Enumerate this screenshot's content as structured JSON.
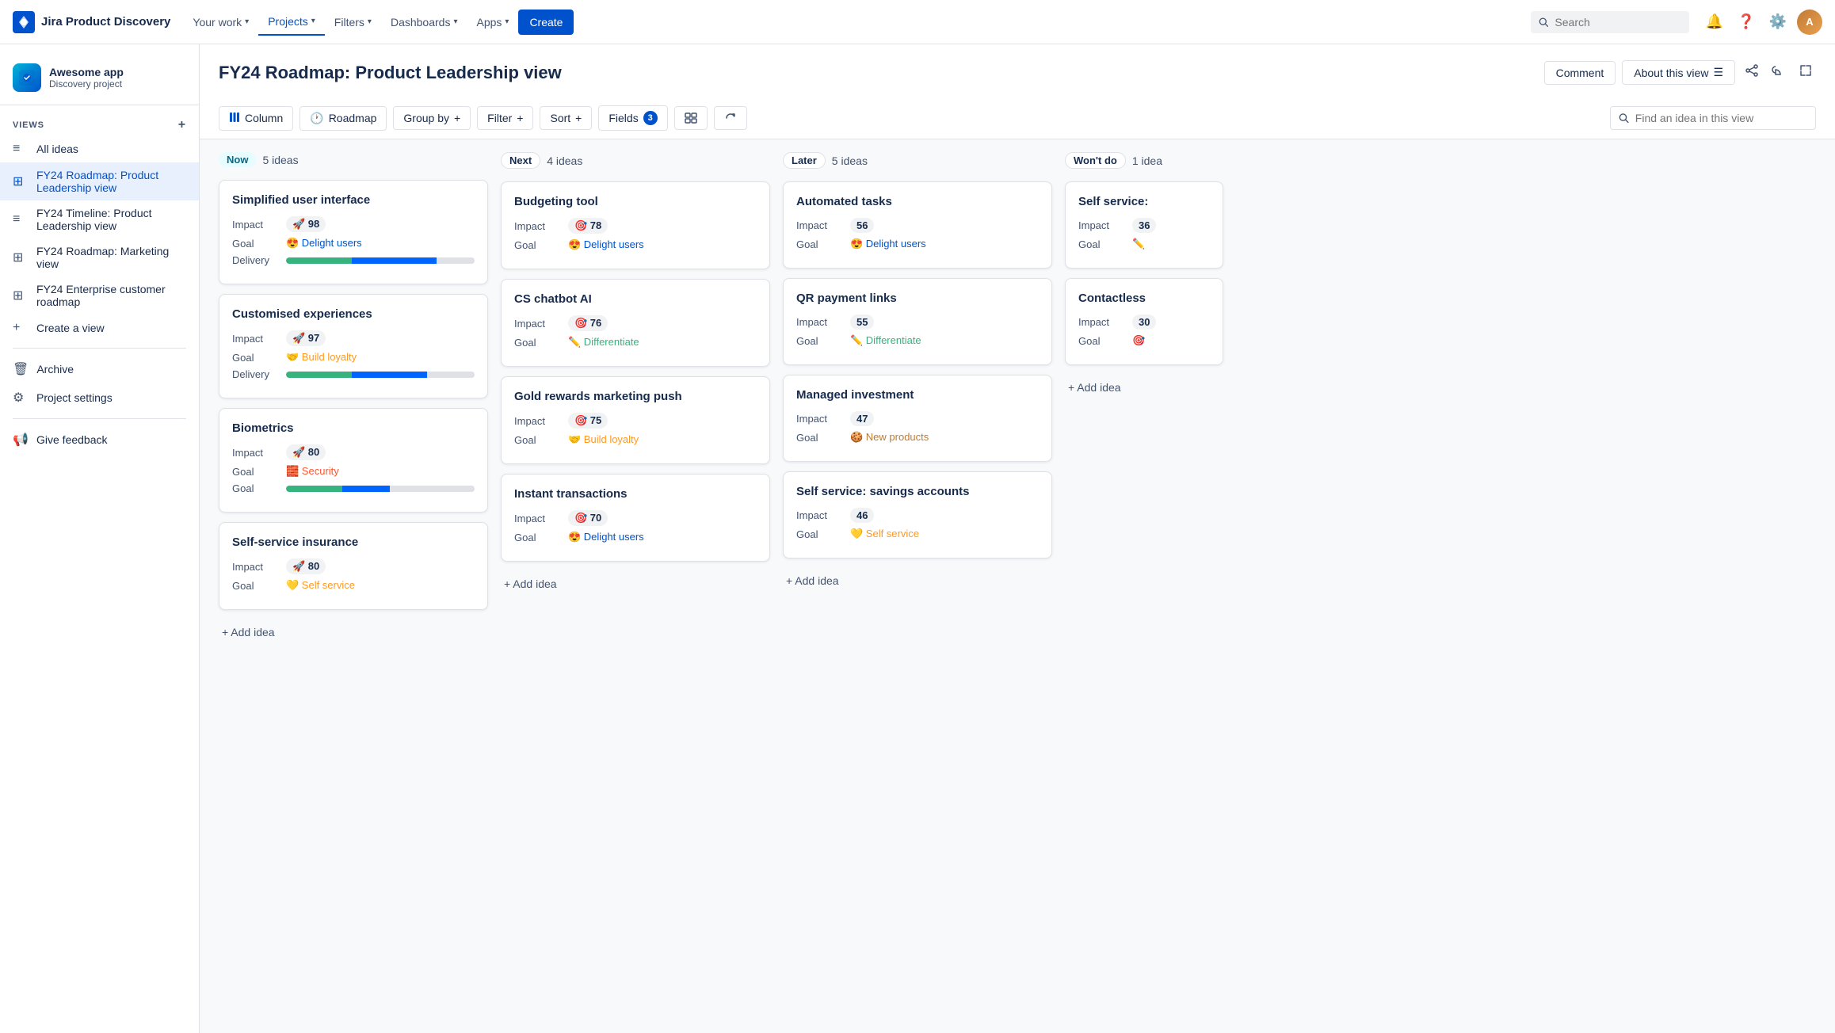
{
  "app": {
    "logo_text": "Jira Product Discovery",
    "nav_items": [
      {
        "label": "Your work",
        "active": false
      },
      {
        "label": "Projects",
        "active": true
      },
      {
        "label": "Filters",
        "active": false
      },
      {
        "label": "Dashboards",
        "active": false
      },
      {
        "label": "Apps",
        "active": false
      }
    ],
    "create_label": "Create",
    "search_placeholder": "Search"
  },
  "sidebar": {
    "project_name": "Awesome app",
    "project_sub": "Discovery project",
    "views_label": "VIEWS",
    "items": [
      {
        "label": "All ideas",
        "icon": "≡",
        "active": false
      },
      {
        "label": "FY24 Roadmap: Product Leadership view",
        "icon": "⊞",
        "active": true
      },
      {
        "label": "FY24 Timeline: Product Leadership view",
        "icon": "≡",
        "active": false
      },
      {
        "label": "FY24 Roadmap: Marketing view",
        "icon": "⊞",
        "active": false
      },
      {
        "label": "FY24 Enterprise customer roadmap",
        "icon": "⊞",
        "active": false
      }
    ],
    "create_view_label": "Create a view",
    "archive_label": "Archive",
    "project_settings_label": "Project settings",
    "give_feedback_label": "Give feedback"
  },
  "page": {
    "title": "FY24 Roadmap: Product Leadership view",
    "comment_label": "Comment",
    "about_view_label": "About this view"
  },
  "toolbar": {
    "column_label": "Column",
    "roadmap_label": "Roadmap",
    "group_by_label": "Group by",
    "filter_label": "Filter",
    "sort_label": "Sort",
    "fields_label": "Fields",
    "fields_count": "3",
    "search_placeholder": "Find an idea in this view"
  },
  "columns": [
    {
      "id": "now",
      "label": "Now",
      "count_label": "5 ideas",
      "badge_class": "now",
      "cards": [
        {
          "title": "Simplified user interface",
          "impact": 98,
          "impact_icon": "🚀",
          "goal": "Delight users",
          "goal_icon": "😍",
          "goal_color": "#0052cc",
          "has_delivery": true,
          "delivery_green": 35,
          "delivery_blue": 45,
          "delivery_gray": 20
        },
        {
          "title": "Customised experiences",
          "impact": 97,
          "impact_icon": "🚀",
          "goal": "Build loyalty",
          "goal_icon": "🤝",
          "goal_color": "#ff991f",
          "has_delivery": true,
          "delivery_green": 35,
          "delivery_blue": 40,
          "delivery_gray": 25
        },
        {
          "title": "Biometrics",
          "impact": 80,
          "impact_icon": "🚀",
          "goal": "Security",
          "goal_icon": "🧱",
          "goal_color": "#ff5630",
          "has_delivery": true,
          "delivery_green": 30,
          "delivery_blue": 25,
          "delivery_gray": 45
        },
        {
          "title": "Self-service insurance",
          "impact": 80,
          "impact_icon": "🚀",
          "goal": "Self service",
          "goal_icon": "💛",
          "goal_color": "#ff991f",
          "has_delivery": false
        }
      ],
      "add_idea_label": "+ Add idea"
    },
    {
      "id": "next",
      "label": "Next",
      "count_label": "4 ideas",
      "badge_class": "next",
      "cards": [
        {
          "title": "Budgeting tool",
          "impact": 78,
          "impact_icon": "🎯",
          "goal": "Delight users",
          "goal_icon": "😍",
          "goal_color": "#0052cc",
          "has_delivery": false
        },
        {
          "title": "CS chatbot AI",
          "impact": 76,
          "impact_icon": "🎯",
          "goal": "Differentiate",
          "goal_icon": "🖊",
          "goal_color": "#36b37e",
          "has_delivery": false
        },
        {
          "title": "Gold rewards marketing push",
          "impact": 75,
          "impact_icon": "🎯",
          "goal": "Build loyalty",
          "goal_icon": "🤝",
          "goal_color": "#ff991f",
          "has_delivery": false
        },
        {
          "title": "Instant transactions",
          "impact": 70,
          "impact_icon": "🎯",
          "goal": "Delight users",
          "goal_icon": "😍",
          "goal_color": "#0052cc",
          "has_delivery": false
        }
      ],
      "add_idea_label": "+ Add idea"
    },
    {
      "id": "later",
      "label": "Later",
      "count_label": "5 ideas",
      "badge_class": "later",
      "cards": [
        {
          "title": "Automated tasks",
          "impact": 56,
          "impact_icon": "",
          "goal": "Delight users",
          "goal_icon": "😍",
          "goal_color": "#0052cc",
          "has_delivery": false
        },
        {
          "title": "QR payment links",
          "impact": 55,
          "impact_icon": "",
          "goal": "Differentiate",
          "goal_icon": "🖊",
          "goal_color": "#36b37e",
          "has_delivery": false
        },
        {
          "title": "Managed investment",
          "impact": 47,
          "impact_icon": "",
          "goal": "New products",
          "goal_icon": "🍪",
          "goal_color": "#c17a30",
          "has_delivery": false
        },
        {
          "title": "Self service: savings accounts",
          "impact": 46,
          "impact_icon": "",
          "goal": "Self service",
          "goal_icon": "💛",
          "goal_color": "#ff991f",
          "has_delivery": false
        }
      ],
      "add_idea_label": "+ Add idea"
    },
    {
      "id": "wontdo",
      "label": "Won't do",
      "count_label": "1 idea",
      "badge_class": "wontdo",
      "cards": [
        {
          "title": "Self service:",
          "impact": 36,
          "impact_icon": "",
          "goal": "",
          "goal_icon": "🖊",
          "goal_color": "#36b37e",
          "has_delivery": false,
          "truncated": true
        },
        {
          "title": "Contactless",
          "impact": 30,
          "impact_icon": "",
          "goal": "",
          "goal_icon": "🎯",
          "goal_color": "#ff991f",
          "has_delivery": false,
          "truncated": true
        }
      ],
      "add_idea_label": "+ Add idea"
    }
  ]
}
